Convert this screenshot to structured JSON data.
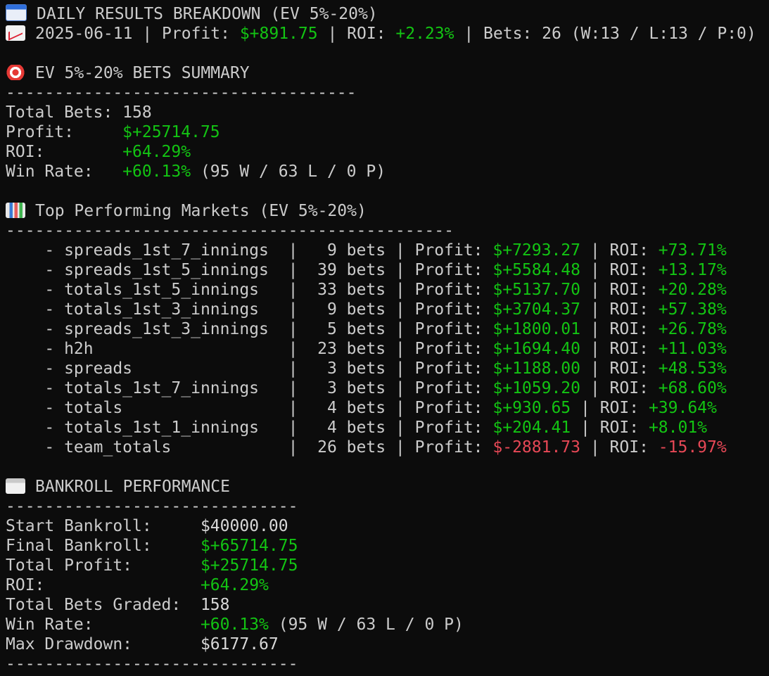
{
  "header": {
    "title": "DAILY RESULTS BREAKDOWN (EV 5%-20%)",
    "date": "2025-06-11",
    "profit_label": "Profit: ",
    "profit_value": "$+891.75",
    "roi_label": "ROI: ",
    "roi_value": "+2.23%",
    "bets_text": "Bets: 26 (W:13 / L:13 / P:0)",
    "icons": [
      "calendar-icon",
      "chart-increasing-icon"
    ]
  },
  "summary": {
    "icon": "target-icon",
    "title": "EV 5%-20% BETS SUMMARY",
    "divider": "------------------------------------",
    "total_bets_label": "Total Bets: ",
    "total_bets_value": "158",
    "profit_label": "Profit:     ",
    "profit_value": "$+25714.75",
    "roi_label": "ROI:        ",
    "roi_value": "+64.29%",
    "win_rate_label": "Win Rate:   ",
    "win_rate_value": "+60.13%",
    "win_rate_detail": " (95 W / 63 L / 0 P)"
  },
  "markets": {
    "icon": "bar-chart-icon",
    "title": "Top Performing Markets (EV 5%-20%)",
    "divider": "----------------------------------------------",
    "rows": [
      {
        "name": "    - spreads_1st_7_innings  |",
        "bets": "   9 bets | Profit: ",
        "profit": "$+7293.27",
        "sep": " | ROI: ",
        "roi": "+73.71%",
        "negative": false
      },
      {
        "name": "    - spreads_1st_5_innings  |",
        "bets": "  39 bets | Profit: ",
        "profit": "$+5584.48",
        "sep": " | ROI: ",
        "roi": "+13.17%",
        "negative": false
      },
      {
        "name": "    - totals_1st_5_innings   |",
        "bets": "  33 bets | Profit: ",
        "profit": "$+5137.70",
        "sep": " | ROI: ",
        "roi": "+20.28%",
        "negative": false
      },
      {
        "name": "    - totals_1st_3_innings   |",
        "bets": "   9 bets | Profit: ",
        "profit": "$+3704.37",
        "sep": " | ROI: ",
        "roi": "+57.38%",
        "negative": false
      },
      {
        "name": "    - spreads_1st_3_innings  |",
        "bets": "   5 bets | Profit: ",
        "profit": "$+1800.01",
        "sep": " | ROI: ",
        "roi": "+26.78%",
        "negative": false
      },
      {
        "name": "    - h2h                    |",
        "bets": "  23 bets | Profit: ",
        "profit": "$+1694.40",
        "sep": " | ROI: ",
        "roi": "+11.03%",
        "negative": false
      },
      {
        "name": "    - spreads                |",
        "bets": "   3 bets | Profit: ",
        "profit": "$+1188.00",
        "sep": " | ROI: ",
        "roi": "+48.53%",
        "negative": false
      },
      {
        "name": "    - totals_1st_7_innings   |",
        "bets": "   3 bets | Profit: ",
        "profit": "$+1059.20",
        "sep": " | ROI: ",
        "roi": "+68.60%",
        "negative": false
      },
      {
        "name": "    - totals                 |",
        "bets": "   4 bets | Profit: ",
        "profit": "$+930.65",
        "sep": " | ROI: ",
        "roi": "+39.64%",
        "negative": false
      },
      {
        "name": "    - totals_1st_1_innings   |",
        "bets": "   4 bets | Profit: ",
        "profit": "$+204.41",
        "sep": " | ROI: ",
        "roi": "+8.01%",
        "negative": false
      },
      {
        "name": "    - team_totals            |",
        "bets": "  26 bets | Profit: ",
        "profit": "$-2881.73",
        "sep": " | ROI: ",
        "roi": "-15.97%",
        "negative": true
      }
    ]
  },
  "bankroll": {
    "icon": "bank-icon",
    "title": "BANKROLL PERFORMANCE",
    "divider": "------------------------------",
    "start_label": "Start Bankroll:     ",
    "start_value": "$40000.00",
    "final_label": "Final Bankroll:     ",
    "final_value": "$+65714.75",
    "profit_label": "Total Profit:       ",
    "profit_value": "$+25714.75",
    "roi_label": "ROI:                ",
    "roi_value": "+64.29%",
    "graded_label": "Total Bets Graded:  ",
    "graded_value": "158",
    "win_rate_label": "Win Rate:           ",
    "win_rate_value": "+60.13%",
    "win_rate_detail": " (95 W / 63 L / 0 P)",
    "drawdown_label": "Max Drawdown:       ",
    "drawdown_value": "$6177.67",
    "bottom_divider": "------------------------------"
  },
  "colors": {
    "background": "#0c0c0c",
    "text": "#cccccc",
    "positive": "#13c413",
    "negative": "#e74856"
  }
}
